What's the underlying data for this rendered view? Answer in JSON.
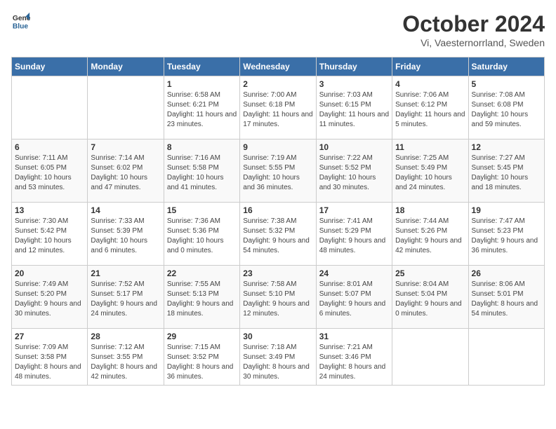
{
  "header": {
    "logo_general": "General",
    "logo_blue": "Blue",
    "month": "October 2024",
    "location": "Vi, Vaesternorrland, Sweden"
  },
  "days_of_week": [
    "Sunday",
    "Monday",
    "Tuesday",
    "Wednesday",
    "Thursday",
    "Friday",
    "Saturday"
  ],
  "weeks": [
    [
      {
        "day": "",
        "sunrise": "",
        "sunset": "",
        "daylight": ""
      },
      {
        "day": "",
        "sunrise": "",
        "sunset": "",
        "daylight": ""
      },
      {
        "day": "1",
        "sunrise": "Sunrise: 6:58 AM",
        "sunset": "Sunset: 6:21 PM",
        "daylight": "Daylight: 11 hours and 23 minutes."
      },
      {
        "day": "2",
        "sunrise": "Sunrise: 7:00 AM",
        "sunset": "Sunset: 6:18 PM",
        "daylight": "Daylight: 11 hours and 17 minutes."
      },
      {
        "day": "3",
        "sunrise": "Sunrise: 7:03 AM",
        "sunset": "Sunset: 6:15 PM",
        "daylight": "Daylight: 11 hours and 11 minutes."
      },
      {
        "day": "4",
        "sunrise": "Sunrise: 7:06 AM",
        "sunset": "Sunset: 6:12 PM",
        "daylight": "Daylight: 11 hours and 5 minutes."
      },
      {
        "day": "5",
        "sunrise": "Sunrise: 7:08 AM",
        "sunset": "Sunset: 6:08 PM",
        "daylight": "Daylight: 10 hours and 59 minutes."
      }
    ],
    [
      {
        "day": "6",
        "sunrise": "Sunrise: 7:11 AM",
        "sunset": "Sunset: 6:05 PM",
        "daylight": "Daylight: 10 hours and 53 minutes."
      },
      {
        "day": "7",
        "sunrise": "Sunrise: 7:14 AM",
        "sunset": "Sunset: 6:02 PM",
        "daylight": "Daylight: 10 hours and 47 minutes."
      },
      {
        "day": "8",
        "sunrise": "Sunrise: 7:16 AM",
        "sunset": "Sunset: 5:58 PM",
        "daylight": "Daylight: 10 hours and 41 minutes."
      },
      {
        "day": "9",
        "sunrise": "Sunrise: 7:19 AM",
        "sunset": "Sunset: 5:55 PM",
        "daylight": "Daylight: 10 hours and 36 minutes."
      },
      {
        "day": "10",
        "sunrise": "Sunrise: 7:22 AM",
        "sunset": "Sunset: 5:52 PM",
        "daylight": "Daylight: 10 hours and 30 minutes."
      },
      {
        "day": "11",
        "sunrise": "Sunrise: 7:25 AM",
        "sunset": "Sunset: 5:49 PM",
        "daylight": "Daylight: 10 hours and 24 minutes."
      },
      {
        "day": "12",
        "sunrise": "Sunrise: 7:27 AM",
        "sunset": "Sunset: 5:45 PM",
        "daylight": "Daylight: 10 hours and 18 minutes."
      }
    ],
    [
      {
        "day": "13",
        "sunrise": "Sunrise: 7:30 AM",
        "sunset": "Sunset: 5:42 PM",
        "daylight": "Daylight: 10 hours and 12 minutes."
      },
      {
        "day": "14",
        "sunrise": "Sunrise: 7:33 AM",
        "sunset": "Sunset: 5:39 PM",
        "daylight": "Daylight: 10 hours and 6 minutes."
      },
      {
        "day": "15",
        "sunrise": "Sunrise: 7:36 AM",
        "sunset": "Sunset: 5:36 PM",
        "daylight": "Daylight: 10 hours and 0 minutes."
      },
      {
        "day": "16",
        "sunrise": "Sunrise: 7:38 AM",
        "sunset": "Sunset: 5:32 PM",
        "daylight": "Daylight: 9 hours and 54 minutes."
      },
      {
        "day": "17",
        "sunrise": "Sunrise: 7:41 AM",
        "sunset": "Sunset: 5:29 PM",
        "daylight": "Daylight: 9 hours and 48 minutes."
      },
      {
        "day": "18",
        "sunrise": "Sunrise: 7:44 AM",
        "sunset": "Sunset: 5:26 PM",
        "daylight": "Daylight: 9 hours and 42 minutes."
      },
      {
        "day": "19",
        "sunrise": "Sunrise: 7:47 AM",
        "sunset": "Sunset: 5:23 PM",
        "daylight": "Daylight: 9 hours and 36 minutes."
      }
    ],
    [
      {
        "day": "20",
        "sunrise": "Sunrise: 7:49 AM",
        "sunset": "Sunset: 5:20 PM",
        "daylight": "Daylight: 9 hours and 30 minutes."
      },
      {
        "day": "21",
        "sunrise": "Sunrise: 7:52 AM",
        "sunset": "Sunset: 5:17 PM",
        "daylight": "Daylight: 9 hours and 24 minutes."
      },
      {
        "day": "22",
        "sunrise": "Sunrise: 7:55 AM",
        "sunset": "Sunset: 5:13 PM",
        "daylight": "Daylight: 9 hours and 18 minutes."
      },
      {
        "day": "23",
        "sunrise": "Sunrise: 7:58 AM",
        "sunset": "Sunset: 5:10 PM",
        "daylight": "Daylight: 9 hours and 12 minutes."
      },
      {
        "day": "24",
        "sunrise": "Sunrise: 8:01 AM",
        "sunset": "Sunset: 5:07 PM",
        "daylight": "Daylight: 9 hours and 6 minutes."
      },
      {
        "day": "25",
        "sunrise": "Sunrise: 8:04 AM",
        "sunset": "Sunset: 5:04 PM",
        "daylight": "Daylight: 9 hours and 0 minutes."
      },
      {
        "day": "26",
        "sunrise": "Sunrise: 8:06 AM",
        "sunset": "Sunset: 5:01 PM",
        "daylight": "Daylight: 8 hours and 54 minutes."
      }
    ],
    [
      {
        "day": "27",
        "sunrise": "Sunrise: 7:09 AM",
        "sunset": "Sunset: 3:58 PM",
        "daylight": "Daylight: 8 hours and 48 minutes."
      },
      {
        "day": "28",
        "sunrise": "Sunrise: 7:12 AM",
        "sunset": "Sunset: 3:55 PM",
        "daylight": "Daylight: 8 hours and 42 minutes."
      },
      {
        "day": "29",
        "sunrise": "Sunrise: 7:15 AM",
        "sunset": "Sunset: 3:52 PM",
        "daylight": "Daylight: 8 hours and 36 minutes."
      },
      {
        "day": "30",
        "sunrise": "Sunrise: 7:18 AM",
        "sunset": "Sunset: 3:49 PM",
        "daylight": "Daylight: 8 hours and 30 minutes."
      },
      {
        "day": "31",
        "sunrise": "Sunrise: 7:21 AM",
        "sunset": "Sunset: 3:46 PM",
        "daylight": "Daylight: 8 hours and 24 minutes."
      },
      {
        "day": "",
        "sunrise": "",
        "sunset": "",
        "daylight": ""
      },
      {
        "day": "",
        "sunrise": "",
        "sunset": "",
        "daylight": ""
      }
    ]
  ]
}
